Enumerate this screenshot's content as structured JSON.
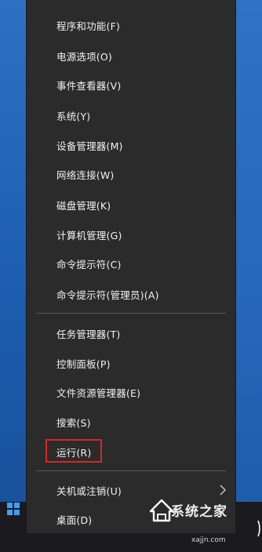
{
  "menu": {
    "items": [
      {
        "label": "程序和功能(F)"
      },
      {
        "label": "电源选项(O)"
      },
      {
        "label": "事件查看器(V)"
      },
      {
        "label": "系统(Y)"
      },
      {
        "label": "设备管理器(M)"
      },
      {
        "label": "网络连接(W)"
      },
      {
        "label": "磁盘管理(K)"
      },
      {
        "label": "计算机管理(G)"
      },
      {
        "label": "命令提示符(C)"
      },
      {
        "label": "命令提示符(管理员)(A)"
      },
      {
        "label": "任务管理器(T)"
      },
      {
        "label": "控制面板(P)"
      },
      {
        "label": "文件资源管理器(E)"
      },
      {
        "label": "搜索(S)"
      },
      {
        "label": "运行(R)"
      },
      {
        "label": "关机或注销(U)"
      },
      {
        "label": "桌面(D)"
      }
    ],
    "highlighted_item": "运行(R)",
    "highlight_color": "#d8262a",
    "background_color": "#2b2b2b",
    "text_color": "#f2f2f2"
  },
  "taskbar": {
    "start_icon": "windows-logo-icon",
    "accent_color": "#3aa0ff"
  },
  "watermark": {
    "title": "系统之家",
    "url": "xajjn.com",
    "icon": "house-logo-icon"
  },
  "desktop": {
    "background_color": "#1e5ea8"
  }
}
